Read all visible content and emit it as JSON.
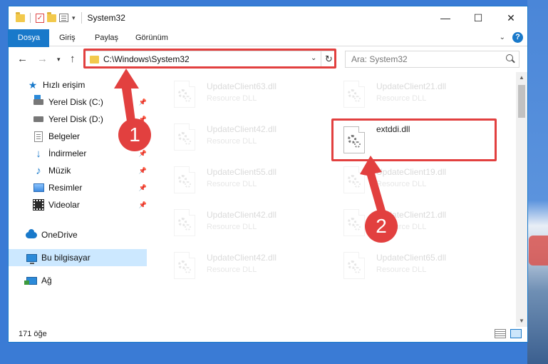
{
  "window": {
    "title": "System32",
    "controls": {
      "minimize": "—",
      "maximize": "☐",
      "close": "✕"
    }
  },
  "ribbon": {
    "tabs": [
      "Dosya",
      "Giriş",
      "Paylaş",
      "Görünüm"
    ],
    "help": "?"
  },
  "address": {
    "path": "C:\\Windows\\System32",
    "search_placeholder": "Ara: System32"
  },
  "nav": {
    "items": [
      {
        "label": "Hızlı erişim",
        "icon": "star-icon",
        "pinned": false,
        "selected": false
      },
      {
        "label": "Yerel Disk (C:)",
        "icon": "drive-c-icon",
        "pinned": true,
        "selected": false
      },
      {
        "label": "Yerel Disk (D:)",
        "icon": "drive-d-icon",
        "pinned": true,
        "selected": false
      },
      {
        "label": "Belgeler",
        "icon": "documents-icon",
        "pinned": true,
        "selected": false
      },
      {
        "label": "İndirmeler",
        "icon": "downloads-icon",
        "pinned": true,
        "selected": false
      },
      {
        "label": "Müzik",
        "icon": "music-icon",
        "pinned": true,
        "selected": false
      },
      {
        "label": "Resimler",
        "icon": "pictures-icon",
        "pinned": true,
        "selected": false
      },
      {
        "label": "Videolar",
        "icon": "videos-icon",
        "pinned": true,
        "selected": false
      },
      {
        "label": "OneDrive",
        "icon": "onedrive-icon",
        "pinned": false,
        "selected": false
      },
      {
        "label": "Bu bilgisayar",
        "icon": "this-pc-icon",
        "pinned": false,
        "selected": true
      },
      {
        "label": "Ağ",
        "icon": "network-icon",
        "pinned": false,
        "selected": false
      }
    ]
  },
  "files": {
    "left": [
      {
        "name": "UpdateClient63.dll",
        "type": "Resource DLL"
      },
      {
        "name": "UpdateClient42.dll",
        "type": "Resource DLL"
      },
      {
        "name": "UpdateClient55.dll",
        "type": "Resource DLL"
      },
      {
        "name": "UpdateClient42.dll",
        "type": "Resource DLL"
      },
      {
        "name": "UpdateClient42.dll",
        "type": "Resource DLL"
      }
    ],
    "right": [
      {
        "name": "UpdateClient21.dll",
        "type": "Resource DLL"
      },
      {
        "name": "extddi.dll",
        "type": ""
      },
      {
        "name": "UpdateClient19.dll",
        "type": "Resource DLL"
      },
      {
        "name": "UpdateClient21.dll",
        "type": "Resource DLL"
      },
      {
        "name": "UpdateClient65.dll",
        "type": "Resource DLL"
      }
    ]
  },
  "status": {
    "count": "171 öğe"
  },
  "callouts": [
    "1",
    "2"
  ],
  "colors": {
    "accent": "#1979ca",
    "highlight": "#e2403f",
    "selected": "#cce8ff"
  }
}
